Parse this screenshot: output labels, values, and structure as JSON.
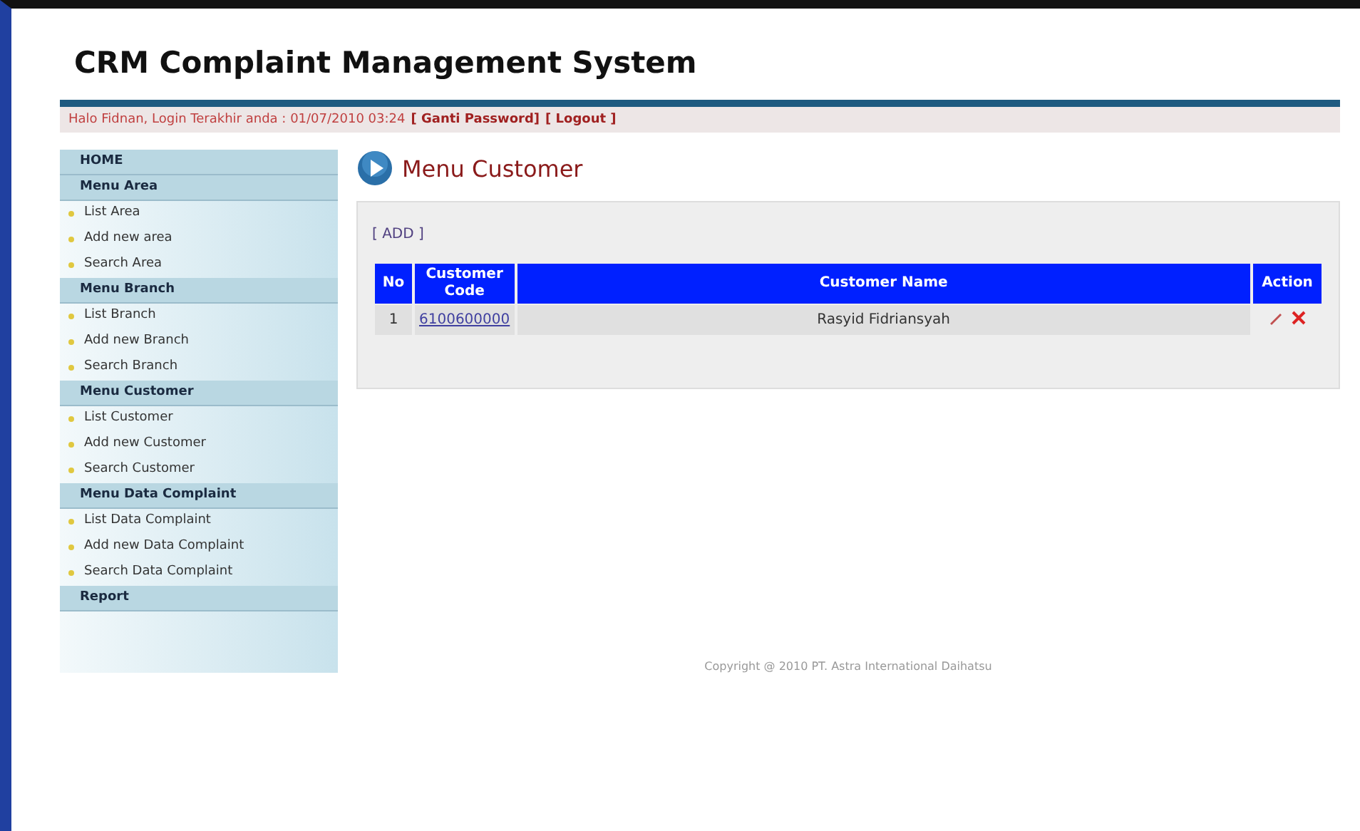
{
  "header": {
    "title": "CRM Complaint Management System",
    "greeting": "Halo Fidnan, Login Terakhir anda : 01/07/2010 03:24",
    "links": [
      "[ Ganti Password]",
      "[ Logout ]"
    ]
  },
  "sidebar": {
    "items": [
      {
        "kind": "heading",
        "label": "HOME"
      },
      {
        "kind": "heading",
        "label": "Menu Area"
      },
      {
        "kind": "link",
        "label": "List Area"
      },
      {
        "kind": "link",
        "label": "Add new area"
      },
      {
        "kind": "link",
        "label": "Search Area"
      },
      {
        "kind": "heading",
        "label": "Menu Branch"
      },
      {
        "kind": "link",
        "label": "List Branch"
      },
      {
        "kind": "link",
        "label": "Add new Branch"
      },
      {
        "kind": "link",
        "label": "Search Branch"
      },
      {
        "kind": "heading",
        "label": "Menu Customer"
      },
      {
        "kind": "link",
        "label": "List Customer"
      },
      {
        "kind": "link",
        "label": "Add new Customer"
      },
      {
        "kind": "link",
        "label": "Search Customer"
      },
      {
        "kind": "heading",
        "label": "Menu Data Complaint"
      },
      {
        "kind": "link",
        "label": "List Data Complaint"
      },
      {
        "kind": "link",
        "label": "Add new Data Complaint"
      },
      {
        "kind": "link",
        "label": "Search Data Complaint"
      },
      {
        "kind": "heading",
        "label": "Report"
      }
    ]
  },
  "content": {
    "title": "Menu Customer",
    "add_link": "[ ADD ]",
    "table": {
      "columns": [
        "No",
        "Customer Code",
        "Customer Name",
        "Action"
      ],
      "rows": [
        {
          "no": "1",
          "code": "6100600000",
          "name": "Rasyid Fidriansyah"
        }
      ]
    }
  },
  "footer": "Copyright @ 2010 PT. Astra International Daihatsu"
}
